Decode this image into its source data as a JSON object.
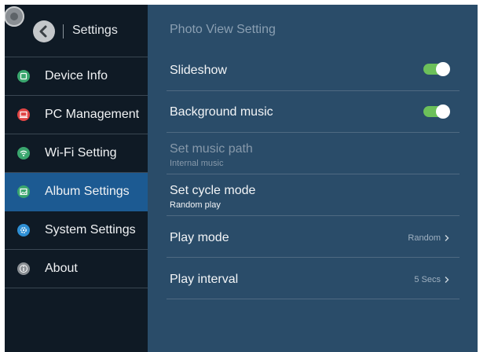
{
  "sidebar": {
    "title": "Settings",
    "items": [
      {
        "label": "Device Info",
        "icon": "device-info-icon",
        "color": "#3aa66e",
        "active": false
      },
      {
        "label": "PC Management",
        "icon": "pc-management-icon",
        "color": "#e04545",
        "active": false
      },
      {
        "label": "Wi-Fi Setting",
        "icon": "wifi-icon",
        "color": "#3aa66e",
        "active": false
      },
      {
        "label": "Album Settings",
        "icon": "album-icon",
        "color": "#3aa66e",
        "active": true
      },
      {
        "label": "System Settings",
        "icon": "system-settings-icon",
        "color": "#2e8fd4",
        "active": false
      },
      {
        "label": "About",
        "icon": "about-icon",
        "color": "#8a8f94",
        "active": false
      }
    ]
  },
  "main": {
    "title": "Photo View Setting",
    "slideshow": {
      "label": "Slideshow",
      "enabled": true
    },
    "background_music": {
      "label": "Background music",
      "enabled": true
    },
    "music_path": {
      "label": "Set music path",
      "sub": "Internal music",
      "disabled": true
    },
    "cycle_mode": {
      "label": "Set cycle mode",
      "sub": "Random play"
    },
    "play_mode": {
      "label": "Play mode",
      "value": "Random"
    },
    "play_interval": {
      "label": "Play interval",
      "value": "5 Secs"
    }
  },
  "colors": {
    "panel": "#2a4c69",
    "sidebar": "#0f1a25",
    "active_item": "#1c5a92",
    "toggle_on": "#6cc05a"
  }
}
